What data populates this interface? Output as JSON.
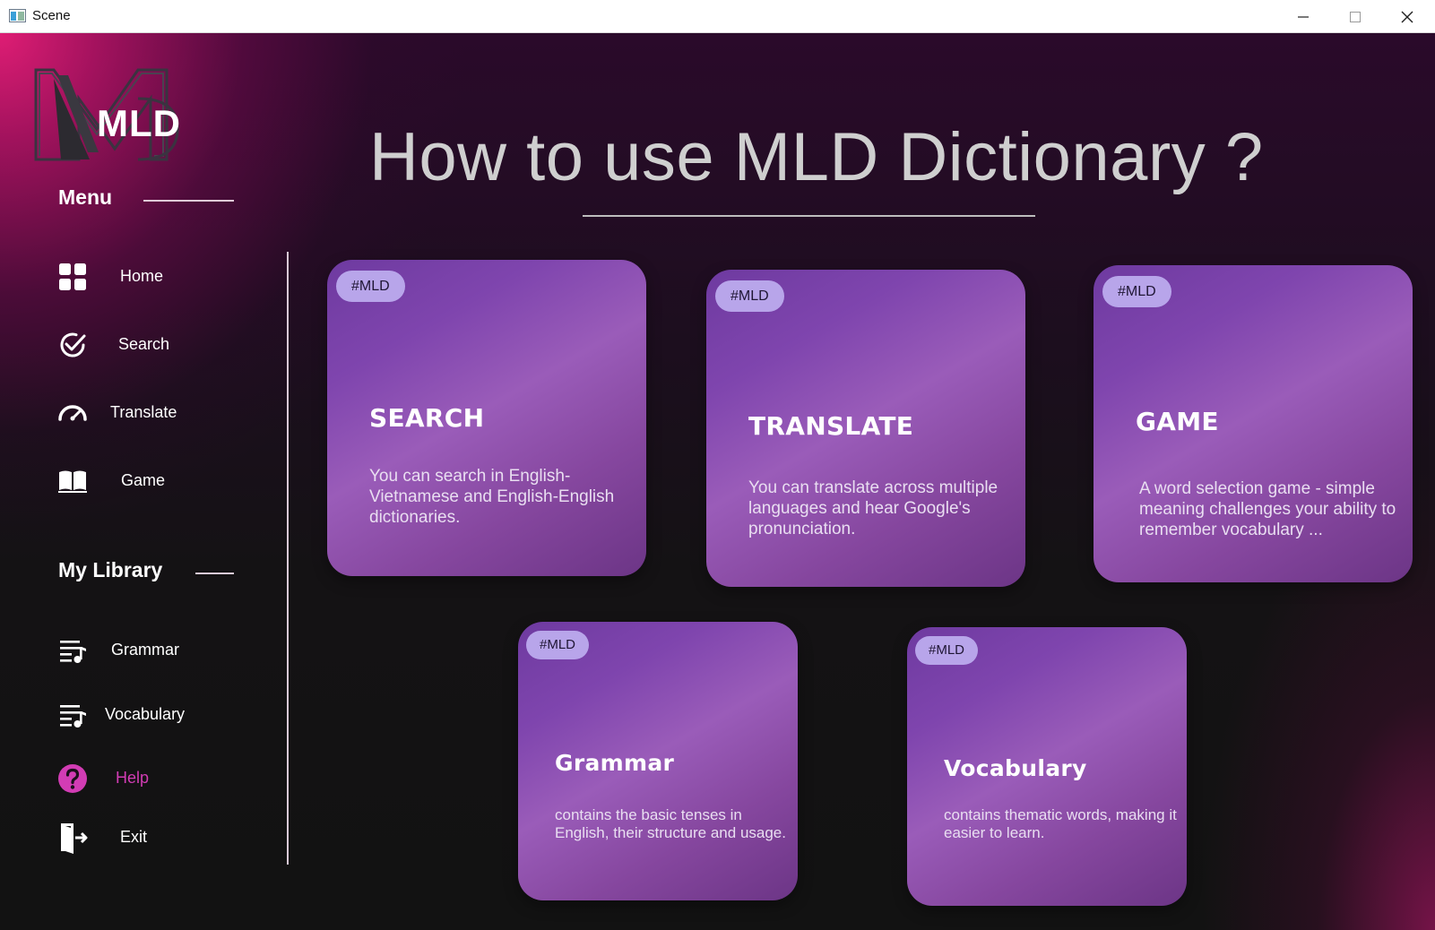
{
  "window": {
    "title": "Scene"
  },
  "logo": {
    "text": "MLD"
  },
  "sidebar": {
    "menu_title": "Menu",
    "menu_items": [
      {
        "label": "Home",
        "icon": "grid-icon"
      },
      {
        "label": "Search",
        "icon": "check-circle-icon"
      },
      {
        "label": "Translate",
        "icon": "speedometer-icon"
      },
      {
        "label": "Game",
        "icon": "book-icon"
      }
    ],
    "library_title": "My Library",
    "library_items": [
      {
        "label": "Grammar",
        "icon": "playlist-icon"
      },
      {
        "label": "Vocabulary",
        "icon": "playlist-icon"
      },
      {
        "label": "Help",
        "icon": "help-icon",
        "active": true
      },
      {
        "label": "Exit",
        "icon": "exit-door-icon"
      }
    ]
  },
  "main": {
    "heading": "How to use MLD Dictionary ?",
    "cards": [
      {
        "tag": "#MLD",
        "title": "SEARCH",
        "description": "You can search in English-Vietnamese and English-English dictionaries."
      },
      {
        "tag": "#MLD",
        "title": "TRANSLATE",
        "description": "You can translate across multiple languages and hear Google's pronunciation."
      },
      {
        "tag": "#MLD",
        "title": "GAME",
        "description": "A word selection game - simple meaning challenges your ability to remember vocabulary ..."
      },
      {
        "tag": "#MLD",
        "title": "Grammar",
        "description": "contains the basic tenses in English, their structure and usage."
      },
      {
        "tag": "#MLD",
        "title": "Vocabulary",
        "description": "contains thematic words, making it easier to learn."
      }
    ]
  },
  "colors": {
    "accent_pink": "#d23cb4",
    "card_purple": "#8a4fb0",
    "tag_lavender": "#b8a5ea"
  }
}
